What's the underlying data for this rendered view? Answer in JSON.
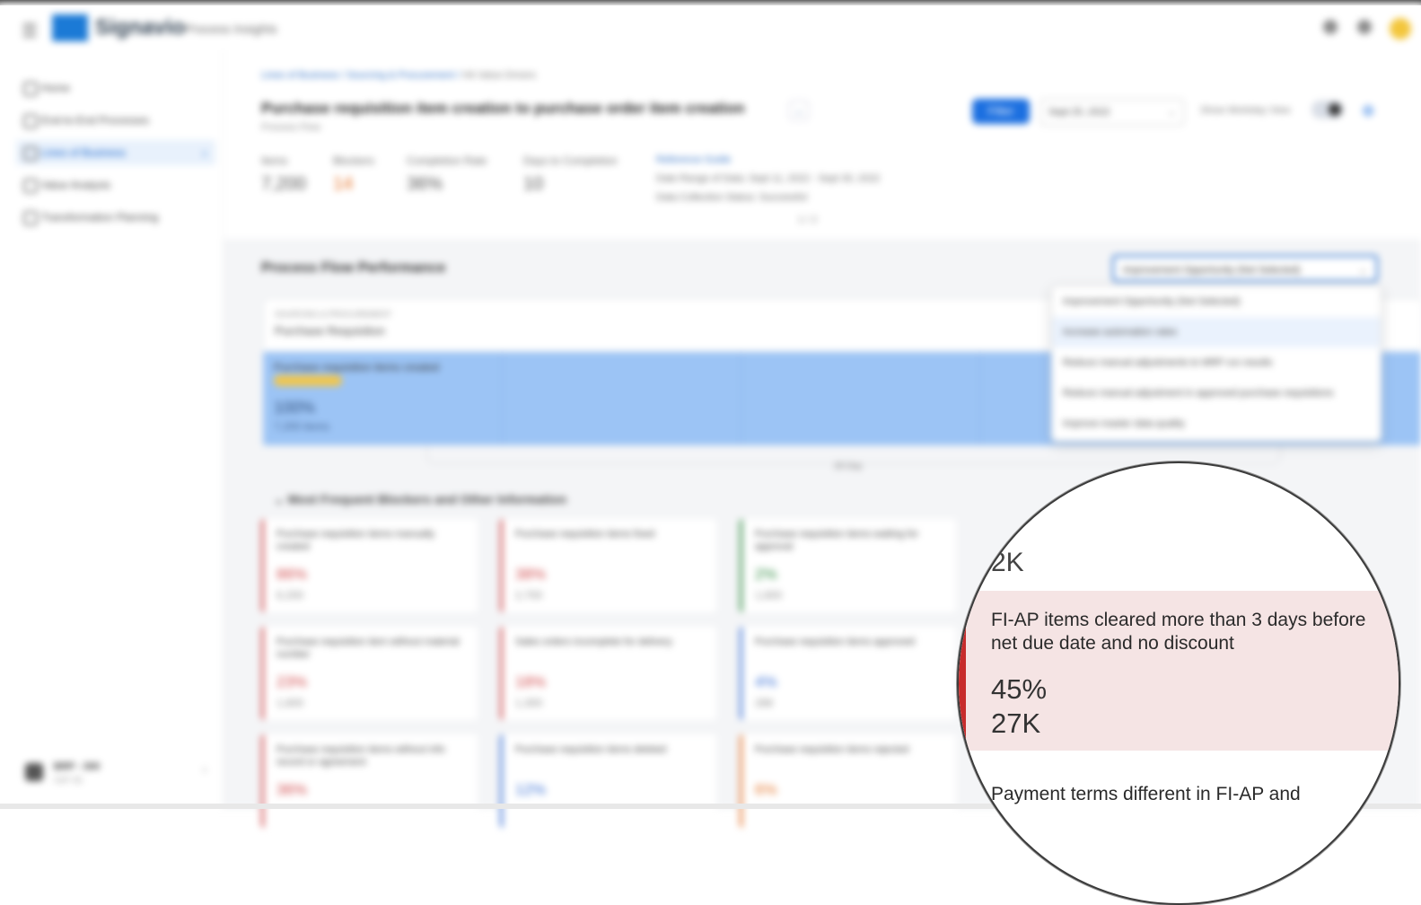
{
  "header": {
    "menu_icon": "hamburger-icon",
    "brand": "Signavio",
    "product": "Process Insights",
    "icons": [
      "help-icon",
      "settings-icon",
      "user-avatar"
    ]
  },
  "sidebar": {
    "items": [
      {
        "label": "Home",
        "icon": "home-icon"
      },
      {
        "label": "End-to-End Processes",
        "icon": "process-icon"
      },
      {
        "label": "Lines of Business",
        "icon": "business-icon",
        "selected": true
      },
      {
        "label": "Value Analysis",
        "icon": "analysis-icon"
      },
      {
        "label": "Transformation Planning",
        "icon": "planning-icon"
      }
    ],
    "user": {
      "name": "BRP - 300",
      "org": "SAP SE"
    }
  },
  "breadcrumb": {
    "first": "Lines of Business",
    "second": "Sourcing & Procurement",
    "current": "Hit Value Drivers"
  },
  "page": {
    "title": "Purchase requisition item creation to purchase order item creation",
    "subtitle": "Process Flow",
    "kpis": [
      {
        "label": "Items",
        "value": "7,200",
        "warn": false
      },
      {
        "label": "Blockers",
        "value": "14",
        "warn": true
      },
      {
        "label": "Completion Rate",
        "value": "36%",
        "warn": false
      },
      {
        "label": "Days to Completion",
        "value": "10",
        "warn": false
      }
    ],
    "reference_label": "Reference Guide",
    "date_range_label": "Date Range of Data: Sept 11, 2022 - Sept 30, 2022",
    "extraction_label": "Data Collection Status: Successful",
    "pager": "1 / 2"
  },
  "toolbar": {
    "filter_label": "Filter",
    "date_value": "Sept 25, 2022",
    "view_label": "Show Workday View"
  },
  "process_flow": {
    "title": "Process Flow Performance",
    "dropdown_value": "Improvement Opportunity (Not Selected)",
    "dropdown_options": [
      "Improvement Opportunity (Not Selected)",
      "Increase automation rates",
      "Reduce manual adjustments to MRP run results",
      "Reduce manual adjustment in approved purchase requisitions",
      "Improve master data quality"
    ],
    "lane_category": "SOURCING & PROCUREMENT",
    "lane_name": "Purchase Requisition",
    "step_title": "Purchase requisition items created",
    "step_percent": "100%",
    "step_items": "7,200 items",
    "flow_days": "28 Day"
  },
  "blockers": {
    "title": "Most Frequent Blockers and Other Information",
    "cards": [
      {
        "text": "Purchase requisition items manually created",
        "percent": "86%",
        "count": "6,200",
        "color": "red"
      },
      {
        "text": "Purchase requisition items fixed",
        "percent": "38%",
        "count": "2,700",
        "color": "red"
      },
      {
        "text": "Purchase requisition items waiting for approval",
        "percent": "2%",
        "count": "1,600",
        "color": "green"
      },
      {
        "text": "Purchase requisition item without material number",
        "percent": "23%",
        "count": "1,600",
        "color": "red"
      },
      {
        "text": "Sales orders incomplete for delivery",
        "percent": "18%",
        "count": "1,300",
        "color": "red"
      },
      {
        "text": "Purchase requisition items approved",
        "percent": "4%",
        "count": "288",
        "color": "blue"
      },
      {
        "text": "Purchase requisition items without info record or agreement",
        "percent": "36%",
        "count": "",
        "color": "red"
      },
      {
        "text": "Purchase requisition items deleted",
        "percent": "12%",
        "count": "",
        "color": "blue"
      },
      {
        "text": "Purchase requisition items rejected",
        "percent": "6%",
        "count": "",
        "color": "orange"
      }
    ]
  },
  "magnifier": {
    "prev_fragment": "0",
    "prev_count": "2K",
    "card_text": "FI-AP items cleared more than 3 days before net due date and no discount",
    "card_percent": "45%",
    "card_count": "27K",
    "next_text": "Payment terms different in FI-AP and"
  },
  "colors": {
    "accent": "#1b6fe0",
    "band": "#9cc4f5",
    "blocker_red": "#d0484a",
    "magnified_card": "#f5e4e4"
  }
}
